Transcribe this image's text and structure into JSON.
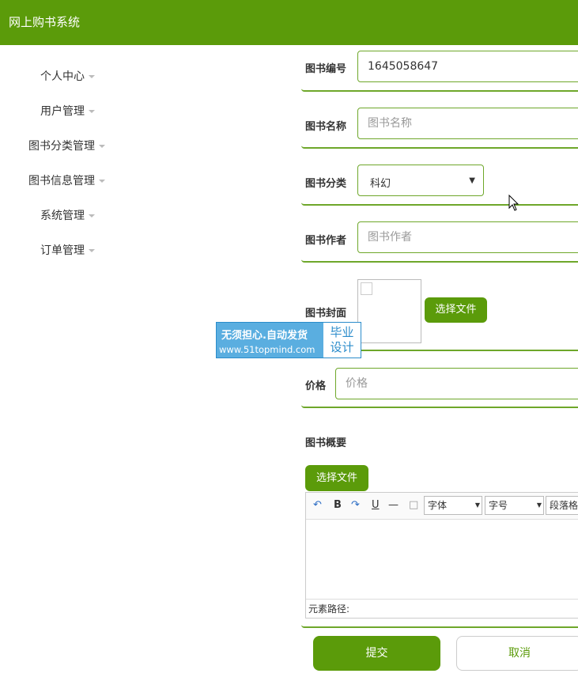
{
  "header": {
    "title": "网上购书系统"
  },
  "sidebar": {
    "items": [
      {
        "label": "个人中心"
      },
      {
        "label": "用户管理"
      },
      {
        "label": "图书分类管理"
      },
      {
        "label": "图书信息管理"
      },
      {
        "label": "系统管理"
      },
      {
        "label": "订单管理"
      }
    ]
  },
  "form": {
    "book_no": {
      "label": "图书编号",
      "value": "1645058647"
    },
    "book_name": {
      "label": "图书名称",
      "placeholder": "图书名称"
    },
    "book_category": {
      "label": "图书分类",
      "selected": "科幻"
    },
    "book_author": {
      "label": "图书作者",
      "placeholder": "图书作者"
    },
    "book_cover": {
      "label": "图书封面",
      "upload_label": "选择文件"
    },
    "price": {
      "label": "价格",
      "placeholder": "价格"
    },
    "summary": {
      "label": "图书概要",
      "upload_label": "选择文件",
      "toolbar": {
        "font_select": "字体",
        "size_select": "字号",
        "paragraph_select": "段落格"
      },
      "status_path": "元素路径:"
    }
  },
  "watermark": {
    "line1": "无须担心.自动发货",
    "line2": "www.51topmind.com",
    "badge1": "毕业",
    "badge2": "设计"
  },
  "actions": {
    "submit": "提交",
    "cancel": "取消"
  },
  "colors": {
    "primary": "#5b9b0a",
    "border_accent": "#6ea72a",
    "watermark": "#5aaee0"
  }
}
